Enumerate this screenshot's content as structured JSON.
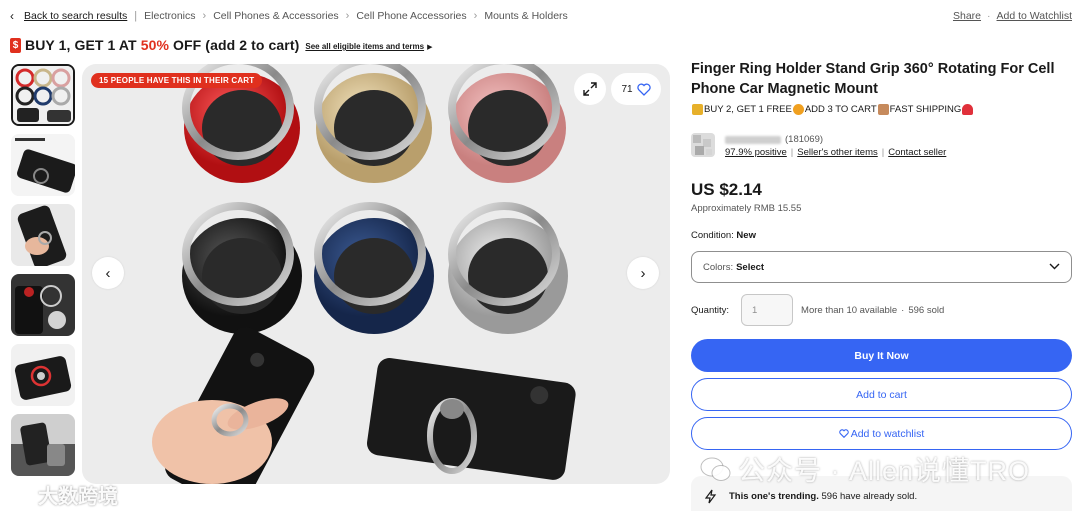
{
  "breadcrumb": {
    "back_label": "Back to search results",
    "items": [
      "Electronics",
      "Cell Phones & Accessories",
      "Cell Phone Accessories",
      "Mounts & Holders"
    ],
    "share_label": "Share",
    "watchlist_label": "Add to Watchlist"
  },
  "promo": {
    "badge": "$",
    "text_start": "BUY 1, GET 1 AT ",
    "text_red": "50%",
    "text_end": " OFF (add 2 to cart)",
    "see_link": "See all eligible items and terms"
  },
  "gallery": {
    "cart_badge": "15 PEOPLE HAVE THIS IN THEIR CART",
    "watch_count": "71",
    "thumbnail_count": 6
  },
  "product": {
    "title": "Finger Ring Holder Stand Grip 360° Rotating For Cell Phone Car Magnetic Mount",
    "subpromo_1": "BUY 2, GET 1 FREE",
    "subpromo_2": "ADD 3 TO CART",
    "subpromo_3": "FAST SHIPPING"
  },
  "seller": {
    "feedback_count": "(181069)",
    "positive": "97.9% positive",
    "other_items": "Seller's other items",
    "contact": "Contact seller"
  },
  "pricing": {
    "price": "US $2.14",
    "approx": "Approximately RMB 15.55"
  },
  "condition": {
    "label": "Condition:",
    "value": "New"
  },
  "colors": {
    "label": "Colors:",
    "value": "Select"
  },
  "quantity": {
    "label": "Quantity:",
    "placeholder": "1",
    "available": "More than 10 available",
    "sold": "596 sold"
  },
  "actions": {
    "buy_now": "Buy It Now",
    "add_to_cart": "Add to cart",
    "add_to_watchlist": "Add to watchlist"
  },
  "trending": {
    "bold": "This one's trending.",
    "rest": " 596 have already sold."
  },
  "watermarks": {
    "right": "公众号 · Allen说懂TRO",
    "left": "大数跨境"
  },
  "colors_theme": {
    "accent": "#3665f3",
    "promo_red": "#e0301e",
    "text": "#191919",
    "muted": "#555555"
  }
}
